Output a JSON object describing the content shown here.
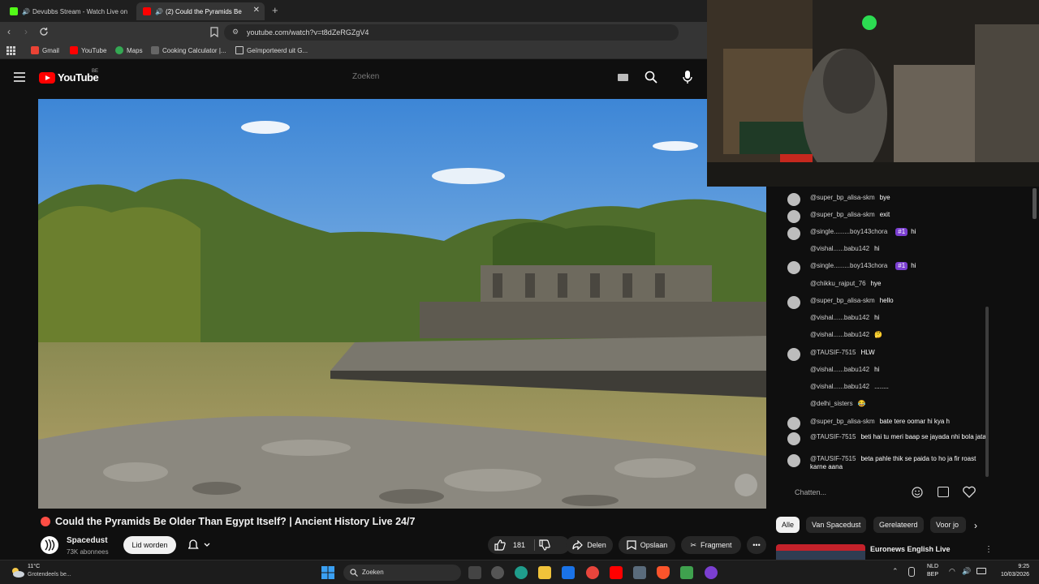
{
  "browser": {
    "tabs": [
      {
        "label": "Devubbs Stream - Watch Live on",
        "active": false
      },
      {
        "label": "(2) Could the Pyramids Be",
        "active": true
      }
    ],
    "new_tab": "+",
    "url": "youtube.com/watch?v=t8dZeRGZgV4",
    "bookmarks": [
      "Gmail",
      "YouTube",
      "Maps",
      "Cooking Calculator |...",
      "Geïmporteerd uit G..."
    ]
  },
  "youtube": {
    "logo_text": "YouTube",
    "logo_region": "BE",
    "search_placeholder": "Zoeken"
  },
  "video": {
    "title": "Could the Pyramids Be Older Than Egypt Itself? | Ancient History Live 24/7",
    "live_indicator_color": "#ff4e45"
  },
  "channel": {
    "name": "Spacedust",
    "subscribers": "73K abonnees",
    "join_label": "Lid worden"
  },
  "actions": {
    "like_count": "181",
    "share": "Delen",
    "save": "Opslaan",
    "clip": "Fragment"
  },
  "chat": {
    "messages": [
      {
        "author": "@super_bp_alisa-skm",
        "text": "bye",
        "badge": ""
      },
      {
        "author": "@super_bp_alisa-skm",
        "text": "exit",
        "badge": ""
      },
      {
        "author": "@single.........boy143chora",
        "text": "hi",
        "badge": "#1"
      },
      {
        "author": "@vishal......babu142",
        "text": "hi",
        "badge": ""
      },
      {
        "author": "@single.........boy143chora",
        "text": "hi",
        "badge": "#1"
      },
      {
        "author": "@chikku_rajput_76",
        "text": "hye",
        "badge": ""
      },
      {
        "author": "@super_bp_alisa-skm",
        "text": "hello",
        "badge": ""
      },
      {
        "author": "@vishal......babu142",
        "text": "hi",
        "badge": ""
      },
      {
        "author": "@vishal......babu142",
        "text": "🤔",
        "badge": ""
      },
      {
        "author": "@TAUSIF-7515",
        "text": "HLW",
        "badge": ""
      },
      {
        "author": "@vishal......babu142",
        "text": "hi",
        "badge": ""
      },
      {
        "author": "@vishal......babu142",
        "text": "........",
        "badge": ""
      },
      {
        "author": "@delhi_sisters",
        "text": "😂",
        "badge": ""
      },
      {
        "author": "@super_bp_alisa-skm",
        "text": "bate tere oomar hi kya h",
        "badge": ""
      },
      {
        "author": "@TAUSIF-7515",
        "text": "beti hai tu meri baap se jayada nhi bola jata",
        "badge": ""
      },
      {
        "author": "@TAUSIF-7515",
        "text": "beta pahle thik se paida to ho ja fir roast karne aana",
        "badge": ""
      }
    ],
    "input_placeholder": "Chatten..."
  },
  "chips": [
    "Alle",
    "Van Spacedust",
    "Gerelateerd",
    "Voor jo"
  ],
  "recommendation": {
    "title": "Euronews English Live"
  },
  "taskbar": {
    "temperature": "11°C",
    "weather": "Grotendeels be...",
    "search_label": "Zoeken",
    "lang_top": "NLD",
    "lang_bottom": "BEP",
    "time": "9:25",
    "date": "10/03/2026"
  }
}
